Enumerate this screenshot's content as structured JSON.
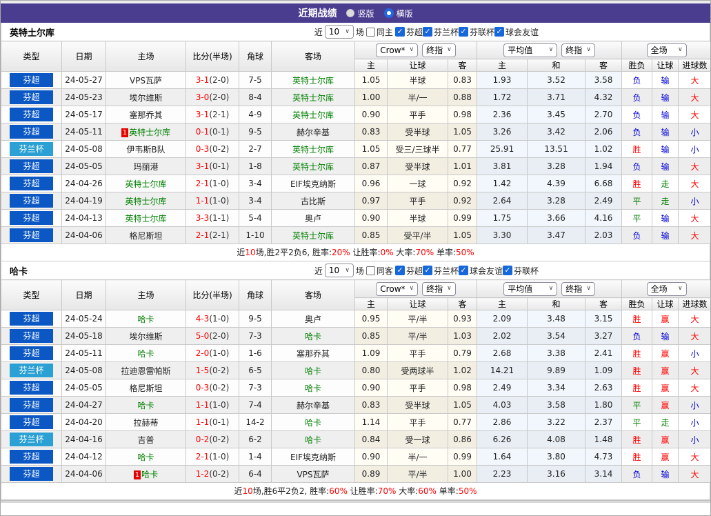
{
  "page": {
    "title": "近期战绩",
    "view_options": [
      {
        "label": "竖版",
        "selected": false
      },
      {
        "label": "横版",
        "selected": true
      }
    ]
  },
  "header": {
    "columns": {
      "type": "类型",
      "date": "日期",
      "home": "主场",
      "score": "比分(半场)",
      "corner": "角球",
      "away": "客场",
      "sub": [
        "主",
        "让球",
        "客",
        "主",
        "和",
        "客",
        "胜负",
        "让球",
        "进球数"
      ]
    },
    "dropdowns": {
      "bookmaker": "Crow*",
      "final1": "终指",
      "average": "平均值",
      "final2": "终指",
      "fulltime": "全场"
    }
  },
  "colors": {
    "accent_purple": "#4a3d8f",
    "league_super": "#0b58c5",
    "league_cup": "#2aa0d4",
    "win_red": "#ff0000",
    "lose_blue": "#0000d8",
    "draw_green": "#008000"
  },
  "sections": [
    {
      "team": "英特土尔库",
      "filter": {
        "recent": "近",
        "count": "10",
        "games": "场",
        "same": "同主",
        "same_checked": false,
        "leagues": [
          "芬超",
          "芬兰杯",
          "芬联杯",
          "球会友谊"
        ]
      },
      "rows": [
        {
          "league": "芬超",
          "cup": false,
          "date": "24-05-27",
          "home": "VPS瓦萨",
          "home_focus": false,
          "home_red": null,
          "score": "3-1",
          "half": "(2-0)",
          "corner": "7-5",
          "away": "英特士尔库",
          "away_focus": true,
          "away_red": null,
          "ah": [
            "1.05",
            "半球",
            "0.83"
          ],
          "eu": [
            "1.93",
            "3.52",
            "3.58"
          ],
          "res": [
            [
              "负",
              "b"
            ],
            [
              "输",
              "b"
            ],
            [
              "大",
              "r"
            ]
          ]
        },
        {
          "league": "芬超",
          "cup": false,
          "date": "24-05-23",
          "home": "埃尔维斯",
          "home_focus": false,
          "home_red": null,
          "score": "3-0",
          "half": "(2-0)",
          "corner": "8-4",
          "away": "英特士尔库",
          "away_focus": true,
          "away_red": null,
          "ah": [
            "1.00",
            "半/一",
            "0.88"
          ],
          "eu": [
            "1.72",
            "3.71",
            "4.32"
          ],
          "res": [
            [
              "负",
              "b"
            ],
            [
              "输",
              "b"
            ],
            [
              "大",
              "r"
            ]
          ]
        },
        {
          "league": "芬超",
          "cup": false,
          "date": "24-05-17",
          "home": "塞那乔其",
          "home_focus": false,
          "home_red": null,
          "score": "3-1",
          "half": "(2-1)",
          "corner": "4-9",
          "away": "英特士尔库",
          "away_focus": true,
          "away_red": null,
          "ah": [
            "0.90",
            "平手",
            "0.98"
          ],
          "eu": [
            "2.36",
            "3.45",
            "2.70"
          ],
          "res": [
            [
              "负",
              "b"
            ],
            [
              "输",
              "b"
            ],
            [
              "大",
              "r"
            ]
          ]
        },
        {
          "league": "芬超",
          "cup": false,
          "date": "24-05-11",
          "home": "英特士尔库",
          "home_focus": true,
          "home_red": "1",
          "score": "0-1",
          "half": "(0-1)",
          "corner": "9-5",
          "away": "赫尔辛基",
          "away_focus": false,
          "away_red": null,
          "ah": [
            "0.83",
            "受半球",
            "1.05"
          ],
          "eu": [
            "3.26",
            "3.42",
            "2.06"
          ],
          "res": [
            [
              "负",
              "b"
            ],
            [
              "输",
              "b"
            ],
            [
              "小",
              "b"
            ]
          ]
        },
        {
          "league": "芬兰杯",
          "cup": true,
          "date": "24-05-08",
          "home": "伊韦斯B队",
          "home_focus": false,
          "home_red": null,
          "score": "0-3",
          "half": "(0-2)",
          "corner": "2-7",
          "away": "英特士尔库",
          "away_focus": true,
          "away_red": null,
          "ah": [
            "1.05",
            "受三/三球半",
            "0.77"
          ],
          "eu": [
            "25.91",
            "13.51",
            "1.02"
          ],
          "res": [
            [
              "胜",
              "r"
            ],
            [
              "输",
              "b"
            ],
            [
              "小",
              "b"
            ]
          ]
        },
        {
          "league": "芬超",
          "cup": false,
          "date": "24-05-05",
          "home": "玛丽港",
          "home_focus": false,
          "home_red": null,
          "score": "3-1",
          "half": "(0-1)",
          "corner": "1-8",
          "away": "英特士尔库",
          "away_focus": true,
          "away_red": null,
          "ah": [
            "0.87",
            "受半球",
            "1.01"
          ],
          "eu": [
            "3.81",
            "3.28",
            "1.94"
          ],
          "res": [
            [
              "负",
              "b"
            ],
            [
              "输",
              "b"
            ],
            [
              "大",
              "r"
            ]
          ]
        },
        {
          "league": "芬超",
          "cup": false,
          "date": "24-04-26",
          "home": "英特士尔库",
          "home_focus": true,
          "home_red": null,
          "score": "2-1",
          "half": "(1-0)",
          "corner": "3-4",
          "away": "EIF埃克纳斯",
          "away_focus": false,
          "away_red": null,
          "ah": [
            "0.96",
            "一球",
            "0.92"
          ],
          "eu": [
            "1.42",
            "4.39",
            "6.68"
          ],
          "res": [
            [
              "胜",
              "r"
            ],
            [
              "走",
              "g"
            ],
            [
              "大",
              "r"
            ]
          ]
        },
        {
          "league": "芬超",
          "cup": false,
          "date": "24-04-19",
          "home": "英特士尔库",
          "home_focus": true,
          "home_red": null,
          "score": "1-1",
          "half": "(1-0)",
          "corner": "3-4",
          "away": "古比斯",
          "away_focus": false,
          "away_red": null,
          "ah": [
            "0.97",
            "平手",
            "0.92"
          ],
          "eu": [
            "2.64",
            "3.28",
            "2.49"
          ],
          "res": [
            [
              "平",
              "g"
            ],
            [
              "走",
              "g"
            ],
            [
              "小",
              "b"
            ]
          ]
        },
        {
          "league": "芬超",
          "cup": false,
          "date": "24-04-13",
          "home": "英特士尔库",
          "home_focus": true,
          "home_red": null,
          "score": "3-3",
          "half": "(1-1)",
          "corner": "5-4",
          "away": "奥卢",
          "away_focus": false,
          "away_red": null,
          "ah": [
            "0.90",
            "半球",
            "0.99"
          ],
          "eu": [
            "1.75",
            "3.66",
            "4.16"
          ],
          "res": [
            [
              "平",
              "g"
            ],
            [
              "输",
              "b"
            ],
            [
              "大",
              "r"
            ]
          ]
        },
        {
          "league": "芬超",
          "cup": false,
          "date": "24-04-06",
          "home": "格尼斯坦",
          "home_focus": false,
          "home_red": null,
          "score": "2-1",
          "half": "(2-1)",
          "corner": "1-10",
          "away": "英特士尔库",
          "away_focus": true,
          "away_red": null,
          "ah": [
            "0.85",
            "受平/半",
            "1.05"
          ],
          "eu": [
            "3.30",
            "3.47",
            "2.03"
          ],
          "res": [
            [
              "负",
              "b"
            ],
            [
              "输",
              "b"
            ],
            [
              "大",
              "r"
            ]
          ]
        }
      ],
      "summary": [
        [
          "近",
          "k"
        ],
        [
          "10",
          "r"
        ],
        [
          "场,胜2平2负6, 胜率:",
          "k"
        ],
        [
          "20%",
          "r"
        ],
        [
          " 让胜率:",
          "k"
        ],
        [
          "0%",
          "r"
        ],
        [
          " 大率:",
          "k"
        ],
        [
          "70%",
          "r"
        ],
        [
          " 单率:",
          "k"
        ],
        [
          "50%",
          "r"
        ]
      ]
    },
    {
      "team": "哈卡",
      "filter": {
        "recent": "近",
        "count": "10",
        "games": "场",
        "same": "同客",
        "same_checked": false,
        "leagues": [
          "芬超",
          "芬兰杯",
          "球会友谊",
          "芬联杯"
        ]
      },
      "rows": [
        {
          "league": "芬超",
          "cup": false,
          "date": "24-05-24",
          "home": "哈卡",
          "home_focus": true,
          "home_red": null,
          "score": "4-3",
          "half": "(1-0)",
          "corner": "9-5",
          "away": "奥卢",
          "away_focus": false,
          "away_red": null,
          "ah": [
            "0.95",
            "平/半",
            "0.93"
          ],
          "eu": [
            "2.09",
            "3.48",
            "3.15"
          ],
          "res": [
            [
              "胜",
              "r"
            ],
            [
              "赢",
              "r"
            ],
            [
              "大",
              "r"
            ]
          ]
        },
        {
          "league": "芬超",
          "cup": false,
          "date": "24-05-18",
          "home": "埃尔维斯",
          "home_focus": false,
          "home_red": null,
          "score": "5-0",
          "half": "(2-0)",
          "corner": "7-3",
          "away": "哈卡",
          "away_focus": true,
          "away_red": null,
          "ah": [
            "0.85",
            "平/半",
            "1.03"
          ],
          "eu": [
            "2.02",
            "3.54",
            "3.27"
          ],
          "res": [
            [
              "负",
              "b"
            ],
            [
              "输",
              "b"
            ],
            [
              "大",
              "r"
            ]
          ]
        },
        {
          "league": "芬超",
          "cup": false,
          "date": "24-05-11",
          "home": "哈卡",
          "home_focus": true,
          "home_red": null,
          "score": "2-0",
          "half": "(1-0)",
          "corner": "1-6",
          "away": "塞那乔其",
          "away_focus": false,
          "away_red": null,
          "ah": [
            "1.09",
            "平手",
            "0.79"
          ],
          "eu": [
            "2.68",
            "3.38",
            "2.41"
          ],
          "res": [
            [
              "胜",
              "r"
            ],
            [
              "赢",
              "r"
            ],
            [
              "小",
              "b"
            ]
          ]
        },
        {
          "league": "芬兰杯",
          "cup": true,
          "date": "24-05-08",
          "home": "拉迪恩雷帕斯",
          "home_focus": false,
          "home_red": null,
          "score": "1-5",
          "half": "(0-2)",
          "corner": "6-5",
          "away": "哈卡",
          "away_focus": true,
          "away_red": null,
          "ah": [
            "0.80",
            "受两球半",
            "1.02"
          ],
          "eu": [
            "14.21",
            "9.89",
            "1.09"
          ],
          "res": [
            [
              "胜",
              "r"
            ],
            [
              "赢",
              "r"
            ],
            [
              "大",
              "r"
            ]
          ]
        },
        {
          "league": "芬超",
          "cup": false,
          "date": "24-05-05",
          "home": "格尼斯坦",
          "home_focus": false,
          "home_red": null,
          "score": "0-3",
          "half": "(0-2)",
          "corner": "7-3",
          "away": "哈卡",
          "away_focus": true,
          "away_red": null,
          "ah": [
            "0.90",
            "平手",
            "0.98"
          ],
          "eu": [
            "2.49",
            "3.34",
            "2.63"
          ],
          "res": [
            [
              "胜",
              "r"
            ],
            [
              "赢",
              "r"
            ],
            [
              "大",
              "r"
            ]
          ]
        },
        {
          "league": "芬超",
          "cup": false,
          "date": "24-04-27",
          "home": "哈卡",
          "home_focus": true,
          "home_red": null,
          "score": "1-1",
          "half": "(1-0)",
          "corner": "7-4",
          "away": "赫尔辛基",
          "away_focus": false,
          "away_red": null,
          "ah": [
            "0.83",
            "受半球",
            "1.05"
          ],
          "eu": [
            "4.03",
            "3.58",
            "1.80"
          ],
          "res": [
            [
              "平",
              "g"
            ],
            [
              "赢",
              "r"
            ],
            [
              "小",
              "b"
            ]
          ]
        },
        {
          "league": "芬超",
          "cup": false,
          "date": "24-04-20",
          "home": "拉赫蒂",
          "home_focus": false,
          "home_red": null,
          "score": "1-1",
          "half": "(0-1)",
          "corner": "14-2",
          "away": "哈卡",
          "away_focus": true,
          "away_red": null,
          "ah": [
            "1.14",
            "平手",
            "0.77"
          ],
          "eu": [
            "2.86",
            "3.22",
            "2.37"
          ],
          "res": [
            [
              "平",
              "g"
            ],
            [
              "走",
              "g"
            ],
            [
              "小",
              "b"
            ]
          ]
        },
        {
          "league": "芬兰杯",
          "cup": true,
          "date": "24-04-16",
          "home": "吉普",
          "home_focus": false,
          "home_red": null,
          "score": "0-2",
          "half": "(0-2)",
          "corner": "6-2",
          "away": "哈卡",
          "away_focus": true,
          "away_red": null,
          "ah": [
            "0.84",
            "受一球",
            "0.86"
          ],
          "eu": [
            "6.26",
            "4.08",
            "1.48"
          ],
          "res": [
            [
              "胜",
              "r"
            ],
            [
              "赢",
              "r"
            ],
            [
              "小",
              "b"
            ]
          ]
        },
        {
          "league": "芬超",
          "cup": false,
          "date": "24-04-12",
          "home": "哈卡",
          "home_focus": true,
          "home_red": null,
          "score": "2-1",
          "half": "(1-0)",
          "corner": "1-4",
          "away": "EIF埃克纳斯",
          "away_focus": false,
          "away_red": null,
          "ah": [
            "0.90",
            "半/一",
            "0.99"
          ],
          "eu": [
            "1.64",
            "3.80",
            "4.73"
          ],
          "res": [
            [
              "胜",
              "r"
            ],
            [
              "赢",
              "r"
            ],
            [
              "大",
              "r"
            ]
          ]
        },
        {
          "league": "芬超",
          "cup": false,
          "date": "24-04-06",
          "home": "哈卡",
          "home_focus": true,
          "home_red": "1",
          "score": "1-2",
          "half": "(0-2)",
          "corner": "6-4",
          "away": "VPS瓦萨",
          "away_focus": false,
          "away_red": null,
          "ah": [
            "0.89",
            "平/半",
            "1.00"
          ],
          "eu": [
            "2.23",
            "3.16",
            "3.14"
          ],
          "res": [
            [
              "负",
              "b"
            ],
            [
              "输",
              "b"
            ],
            [
              "大",
              "r"
            ]
          ]
        }
      ],
      "summary": [
        [
          "近",
          "k"
        ],
        [
          "10",
          "r"
        ],
        [
          "场,胜6平2负2, 胜率:",
          "k"
        ],
        [
          "60%",
          "r"
        ],
        [
          " 让胜率:",
          "k"
        ],
        [
          "70%",
          "r"
        ],
        [
          " 大率:",
          "k"
        ],
        [
          "60%",
          "r"
        ],
        [
          " 单率:",
          "k"
        ],
        [
          "50%",
          "r"
        ]
      ]
    }
  ]
}
